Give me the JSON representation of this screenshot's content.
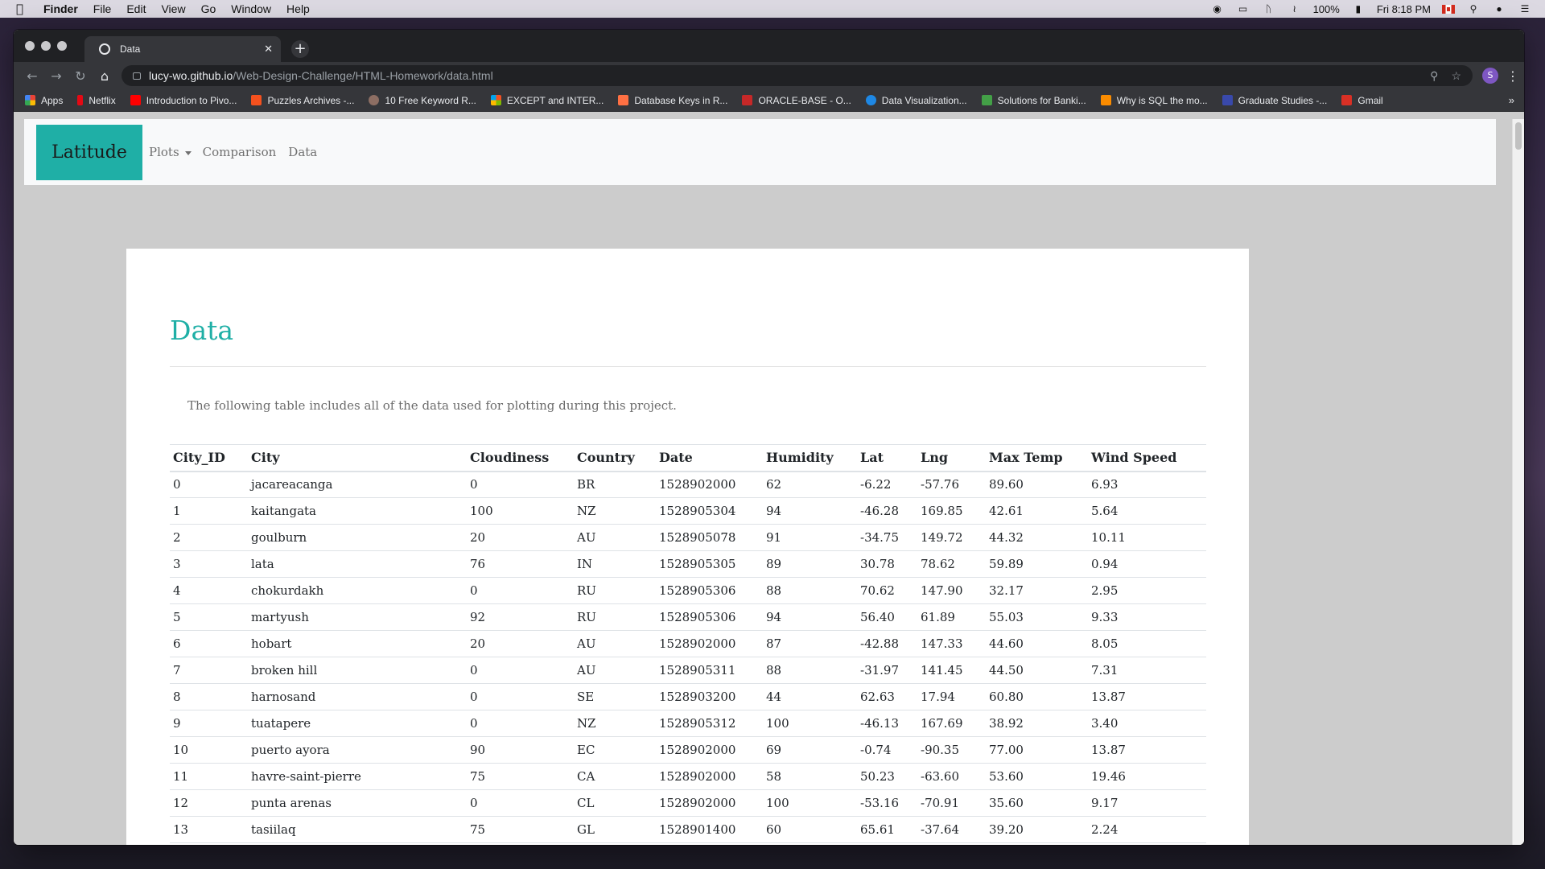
{
  "menubar": {
    "app": "Finder",
    "items": [
      "File",
      "Edit",
      "View",
      "Go",
      "Window",
      "Help"
    ],
    "battery": "100%",
    "clock": "Fri 8:18 PM"
  },
  "browser": {
    "tab_title": "Data",
    "new_tab": "+",
    "close": "✕",
    "url_host": "lucy-wo.github.io",
    "url_path": "/Web-Design-Challenge/HTML-Homework/data.html",
    "profile_initial": "S",
    "bookmarks": [
      {
        "label": "Apps",
        "color": "#ea4335"
      },
      {
        "label": "Netflix",
        "color": "#e50914"
      },
      {
        "label": "Introduction to Pivo...",
        "color": "#ff0000"
      },
      {
        "label": "Puzzles Archives -...",
        "color": "#f4511e"
      },
      {
        "label": "10 Free Keyword R...",
        "color": "#8d6e63"
      },
      {
        "label": "EXCEPT and INTER...",
        "color": "#4285f4"
      },
      {
        "label": "Database Keys in R...",
        "color": "#ff7043"
      },
      {
        "label": "ORACLE-BASE - O...",
        "color": "#c62828"
      },
      {
        "label": "Data Visualization...",
        "color": "#1e88e5"
      },
      {
        "label": "Solutions for Banki...",
        "color": "#43a047"
      },
      {
        "label": "Why is SQL the mo...",
        "color": "#fb8c00"
      },
      {
        "label": "Graduate Studies -...",
        "color": "#3949ab"
      },
      {
        "label": "Gmail",
        "color": "#d93025"
      }
    ]
  },
  "nav": {
    "brand": "Latitude",
    "plots": "Plots",
    "comparison": "Comparison",
    "data": "Data"
  },
  "page": {
    "heading": "Data",
    "intro": "The following table includes all of the data used for plotting during this project."
  },
  "table": {
    "headers": [
      "City_ID",
      "City",
      "Cloudiness",
      "Country",
      "Date",
      "Humidity",
      "Lat",
      "Lng",
      "Max Temp",
      "Wind Speed"
    ],
    "rows": [
      [
        "0",
        "jacareacanga",
        "0",
        "BR",
        "1528902000",
        "62",
        "-6.22",
        "-57.76",
        "89.60",
        "6.93"
      ],
      [
        "1",
        "kaitangata",
        "100",
        "NZ",
        "1528905304",
        "94",
        "-46.28",
        "169.85",
        "42.61",
        "5.64"
      ],
      [
        "2",
        "goulburn",
        "20",
        "AU",
        "1528905078",
        "91",
        "-34.75",
        "149.72",
        "44.32",
        "10.11"
      ],
      [
        "3",
        "lata",
        "76",
        "IN",
        "1528905305",
        "89",
        "30.78",
        "78.62",
        "59.89",
        "0.94"
      ],
      [
        "4",
        "chokurdakh",
        "0",
        "RU",
        "1528905306",
        "88",
        "70.62",
        "147.90",
        "32.17",
        "2.95"
      ],
      [
        "5",
        "martyush",
        "92",
        "RU",
        "1528905306",
        "94",
        "56.40",
        "61.89",
        "55.03",
        "9.33"
      ],
      [
        "6",
        "hobart",
        "20",
        "AU",
        "1528902000",
        "87",
        "-42.88",
        "147.33",
        "44.60",
        "8.05"
      ],
      [
        "7",
        "broken hill",
        "0",
        "AU",
        "1528905311",
        "88",
        "-31.97",
        "141.45",
        "44.50",
        "7.31"
      ],
      [
        "8",
        "harnosand",
        "0",
        "SE",
        "1528903200",
        "44",
        "62.63",
        "17.94",
        "60.80",
        "13.87"
      ],
      [
        "9",
        "tuatapere",
        "0",
        "NZ",
        "1528905312",
        "100",
        "-46.13",
        "167.69",
        "38.92",
        "3.40"
      ],
      [
        "10",
        "puerto ayora",
        "90",
        "EC",
        "1528902000",
        "69",
        "-0.74",
        "-90.35",
        "77.00",
        "13.87"
      ],
      [
        "11",
        "havre-saint-pierre",
        "75",
        "CA",
        "1528902000",
        "58",
        "50.23",
        "-63.60",
        "53.60",
        "19.46"
      ],
      [
        "12",
        "punta arenas",
        "0",
        "CL",
        "1528902000",
        "100",
        "-53.16",
        "-70.91",
        "35.60",
        "9.17"
      ],
      [
        "13",
        "tasiilaq",
        "75",
        "GL",
        "1528901400",
        "60",
        "65.61",
        "-37.64",
        "39.20",
        "2.24"
      ]
    ]
  },
  "colors": {
    "accent": "#1fafa6",
    "navbar_bg": "#f8f9fa",
    "page_bg": "#cccccc"
  }
}
